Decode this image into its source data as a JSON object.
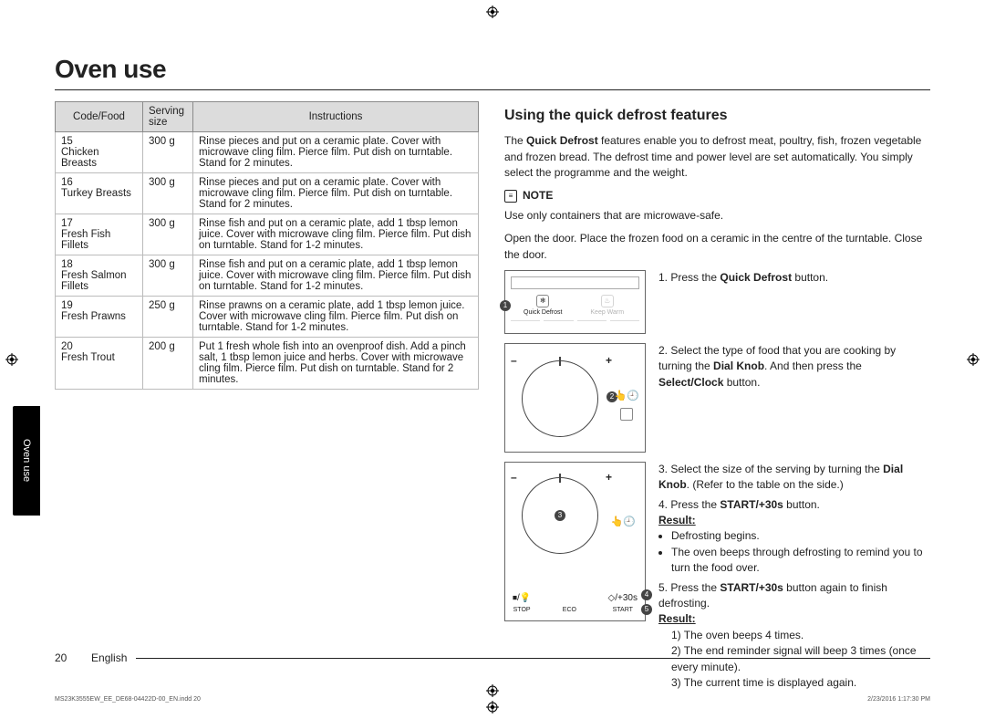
{
  "page": {
    "section_title": "Oven use",
    "side_tab": "Oven use",
    "footer_page": "20",
    "footer_lang": "English",
    "print_file": "MS23K3555EW_EE_DE68-04422D-00_EN.indd   20",
    "print_date": "2/23/2016   1:17:30 PM"
  },
  "table": {
    "headers": {
      "code": "Code/Food",
      "size": "Serving size",
      "instr": "Instructions"
    },
    "rows": [
      {
        "code": "15",
        "name": "Chicken Breasts",
        "size": "300 g",
        "instr": "Rinse pieces and put on a ceramic plate. Cover with microwave cling film. Pierce film. Put dish on turntable. Stand for 2 minutes."
      },
      {
        "code": "16",
        "name": "Turkey Breasts",
        "size": "300 g",
        "instr": "Rinse pieces and put on a ceramic plate. Cover with microwave cling film. Pierce film. Put dish on turntable. Stand for 2 minutes."
      },
      {
        "code": "17",
        "name": "Fresh Fish Fillets",
        "size": "300 g",
        "instr": "Rinse fish and put on a ceramic plate, add 1 tbsp lemon juice. Cover with microwave cling film. Pierce film. Put dish on turntable. Stand for 1-2 minutes."
      },
      {
        "code": "18",
        "name": "Fresh Salmon Fillets",
        "size": "300 g",
        "instr": "Rinse fish and put on a ceramic plate, add 1 tbsp lemon juice. Cover with microwave cling film. Pierce film. Put dish on turntable. Stand for 1-2 minutes."
      },
      {
        "code": "19",
        "name": "Fresh Prawns",
        "size": "250 g",
        "instr": "Rinse prawns on a ceramic plate, add 1 tbsp lemon juice. Cover with microwave cling film. Pierce film. Put dish on turntable. Stand for 1-2 minutes."
      },
      {
        "code": "20",
        "name": "Fresh Trout",
        "size": "200 g",
        "instr": "Put 1 fresh whole fish into an ovenproof dish. Add a pinch salt, 1 tbsp lemon juice and herbs. Cover with microwave cling film. Pierce film. Put dish on turntable. Stand for 2 minutes."
      }
    ]
  },
  "right": {
    "heading": "Using the quick defrost features",
    "intro": "The Quick Defrost features enable you to defrost meat, poultry, fish, frozen vegetable and frozen bread. The defrost time and power level are set automatically. You simply select the programme and the weight.",
    "note_label": "NOTE",
    "note_text": "Use only containers that are microwave-safe.",
    "open_door": "Open the door. Place the frozen food on a ceramic in the centre of the turntable. Close the door.",
    "panel1": {
      "btn1": "Quick Defrost",
      "btn2": "Keep Warm"
    },
    "panel3": {
      "stop": "STOP",
      "eco": "ECO",
      "start": "START",
      "plus30": "/+30s"
    },
    "steps": {
      "s1_pre": "1. Press the ",
      "s1_b": "Quick Defrost",
      "s1_post": " button.",
      "s2_pre": "2. Select the type of food that you are cooking by turning the ",
      "s2_b1": "Dial Knob",
      "s2_mid": ". And then press the ",
      "s2_b2": "Select/Clock",
      "s2_post": " button.",
      "s3_pre": "3. Select the size of the serving by turning the ",
      "s3_b": "Dial Knob",
      "s3_post": ". (Refer to the table on the side.)",
      "s4_pre": "4. Press the ",
      "s4_b": "START/+30s",
      "s4_post": " button.",
      "result_label": "Result:",
      "r4_a": "Defrosting begins.",
      "r4_b": "The oven beeps through defrosting to remind you to turn the food over.",
      "s5_pre": "5. Press the ",
      "s5_b": "START/+30s",
      "s5_post": " button again to finish defrosting.",
      "r5_1": "1)  The oven beeps 4 times.",
      "r5_2": "2)  The end reminder signal will beep 3 times (once every minute).",
      "r5_3": "3)  The current time is displayed again."
    }
  }
}
